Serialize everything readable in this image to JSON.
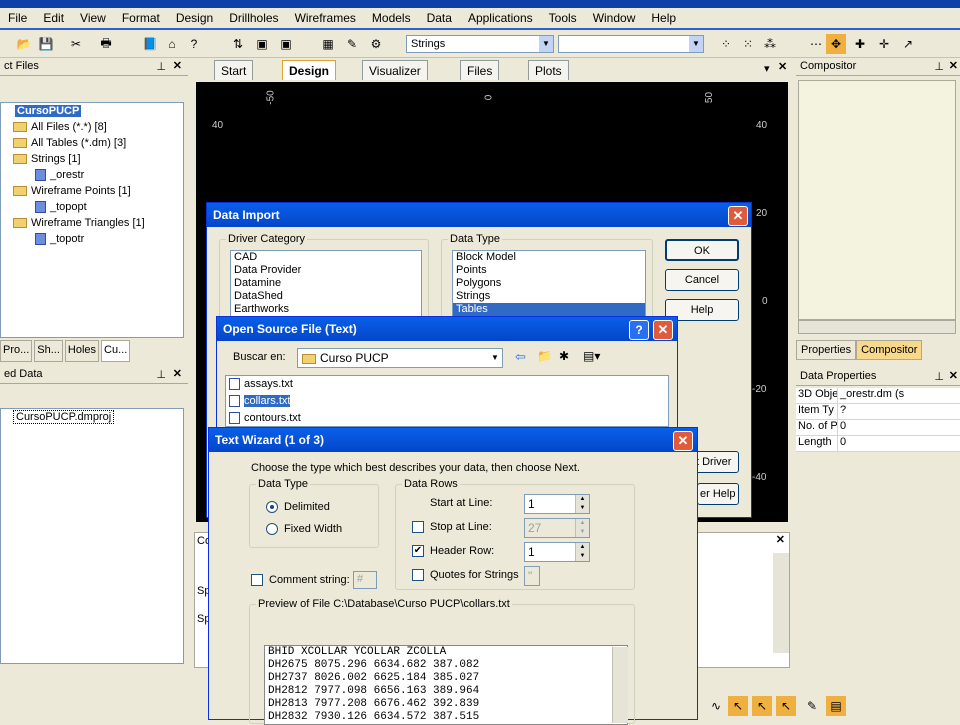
{
  "menu": [
    "File",
    "Edit",
    "View",
    "Format",
    "Design",
    "Drillholes",
    "Wireframes",
    "Models",
    "Data",
    "Applications",
    "Tools",
    "Window",
    "Help"
  ],
  "toolbar": {
    "strings_combo": "Strings"
  },
  "project_files": {
    "title": "ct Files",
    "items": [
      "CursoPUCP",
      "All Files (*.*) [8]",
      "All Tables (*.dm) [3]",
      "Strings [1]",
      "_orestr",
      "Wireframe Points [1]",
      "_topopt",
      "Wireframe Triangles [1]",
      "_topotr"
    ],
    "bottom_tabs": [
      "Pro...",
      "Sh...",
      "Holes",
      "Cu..."
    ]
  },
  "loaded_data": {
    "title": "ed Data",
    "items": [
      "CursoPUCP.dmproj"
    ]
  },
  "tabs": [
    "Start",
    "Design",
    "Visualizer",
    "Files",
    "Plots"
  ],
  "viewport": {
    "top_labels": [
      "-50",
      "0",
      "50"
    ],
    "left_labels": [
      "40"
    ],
    "right_labels": [
      "40",
      "20",
      "0",
      "-20",
      "-40"
    ]
  },
  "compositor": {
    "title": "Compositor",
    "tab_properties": "Properties",
    "tab_compositor": "Compositor"
  },
  "data_properties": {
    "title": "Data Properties",
    "rows": [
      [
        "3D Obje",
        "_orestr.dm (s"
      ],
      [
        "Item Ty",
        "?"
      ],
      [
        "No. of P",
        "0"
      ],
      [
        "Length",
        "0"
      ]
    ]
  },
  "data_import": {
    "title": "Data Import",
    "driver_category_label": "Driver Category",
    "driver_categories": [
      "CAD",
      "Data Provider",
      "Datamine",
      "DataShed",
      "Earthworks"
    ],
    "data_type_label": "Data Type",
    "data_types": [
      "Block Model",
      "Points",
      "Polygons",
      "Strings",
      "Tables"
    ],
    "ok": "OK",
    "cancel": "Cancel",
    "help": "Help",
    "driver_btn": "t Driver",
    "help2_btn": "er Help"
  },
  "open_source": {
    "title": "Open Source File (Text)",
    "look_in_label": "Buscar en:",
    "look_in_value": "Curso PUCP",
    "files": [
      "assays.txt",
      "collars.txt",
      "contours.txt"
    ]
  },
  "text_wizard": {
    "title": "Text Wizard (1 of 3)",
    "instruction": "Choose the type which best describes your data, then choose Next.",
    "data_type_label": "Data Type",
    "delimited": "Delimited",
    "fixed_width": "Fixed Width",
    "data_rows_label": "Data Rows",
    "start_at_line": "Start at Line:",
    "start_value": "1",
    "stop_at_line": "Stop at Line:",
    "stop_value": "27",
    "header_row": "Header Row:",
    "header_value": "1",
    "quotes": "Quotes for Strings",
    "quotes_value": "\"",
    "comment_string": "Comment string:",
    "comment_value": "#",
    "preview_label": "Preview of File C:\\Database\\Curso PUCP\\collars.txt",
    "preview_header": [
      "BHID",
      "XCOLLAR",
      "YCOLLAR",
      "ZCOLLA"
    ],
    "preview_rows": [
      [
        "DH2675",
        "8075.296",
        "6634.682",
        "387.082"
      ],
      [
        "DH2737",
        "8026.002",
        "6625.184",
        "385.027"
      ],
      [
        "DH2812",
        "7977.098",
        "6656.163",
        "389.964"
      ],
      [
        "DH2813",
        "7977.208",
        "6676.462",
        "392.839"
      ],
      [
        "DH2832",
        "7930.126",
        "6634.572",
        "387.515"
      ]
    ]
  },
  "background": {
    "co_label": "Co",
    "sp1": "Sp",
    "sp2": "Sp"
  }
}
